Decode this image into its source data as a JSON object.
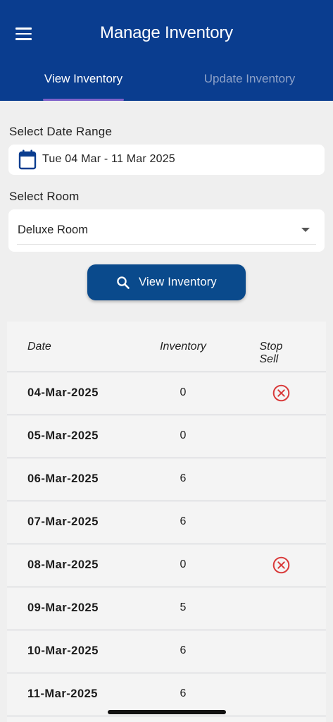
{
  "header": {
    "title": "Manage Inventory",
    "menu_icon": "hamburger-menu-icon",
    "bar_color": "#0a3d8f"
  },
  "tabs": [
    {
      "label": "View Inventory",
      "active": true
    },
    {
      "label": "Update Inventory",
      "active": false
    }
  ],
  "date_range": {
    "label": "Select Date Range",
    "value": "Tue 04 Mar - 11 Mar 2025",
    "icon": "calendar-icon"
  },
  "room": {
    "label": "Select Room",
    "value": "Deluxe Room",
    "icon": "dropdown-caret-icon"
  },
  "action": {
    "label": "View Inventory",
    "icon": "search-icon",
    "color": "#0a4a8c"
  },
  "table": {
    "headers": {
      "date": "Date",
      "inventory": "Inventory",
      "stop_sell": "Stop Sell"
    },
    "rows": [
      {
        "date": "04-Mar-2025",
        "inventory": "0",
        "stop_sell": true
      },
      {
        "date": "05-Mar-2025",
        "inventory": "0",
        "stop_sell": false
      },
      {
        "date": "06-Mar-2025",
        "inventory": "6",
        "stop_sell": false
      },
      {
        "date": "07-Mar-2025",
        "inventory": "6",
        "stop_sell": false
      },
      {
        "date": "08-Mar-2025",
        "inventory": "0",
        "stop_sell": true
      },
      {
        "date": "09-Mar-2025",
        "inventory": "5",
        "stop_sell": false
      },
      {
        "date": "10-Mar-2025",
        "inventory": "6",
        "stop_sell": false
      },
      {
        "date": "11-Mar-2025",
        "inventory": "6",
        "stop_sell": false
      }
    ],
    "stop_sell_icon": "close-circle-icon",
    "stop_sell_color": "#d93a3a"
  }
}
